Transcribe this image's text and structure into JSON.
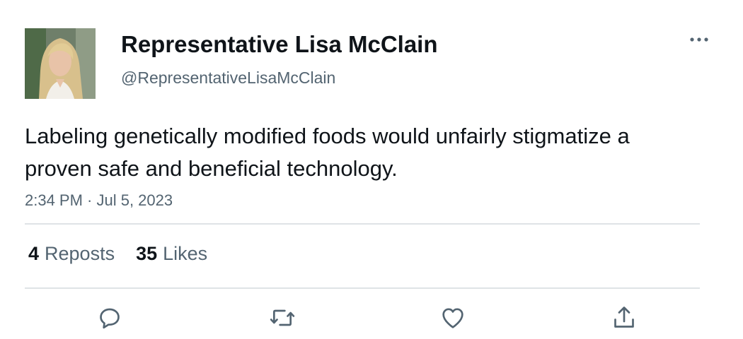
{
  "tweet": {
    "author": {
      "display_name": "Representative Lisa McClain",
      "handle": "@RepresentativeLisaMcClain",
      "avatar_icon": "profile-photo"
    },
    "text": "Labeling genetically modified foods would unfairly stigmatize a proven safe and beneficial technology.",
    "timestamp": "2:34 PM · Jul 5, 2023",
    "stats": {
      "reposts_count": "4",
      "reposts_label": "Reposts",
      "likes_count": "35",
      "likes_label": "Likes"
    },
    "actions": {
      "more_icon": "more-horizontal-icon",
      "reply_icon": "reply-icon",
      "repost_icon": "repost-icon",
      "like_icon": "heart-icon",
      "share_icon": "share-icon"
    }
  },
  "colors": {
    "text_primary": "#0f1419",
    "text_secondary": "#536471",
    "divider": "#dfe3e6"
  }
}
